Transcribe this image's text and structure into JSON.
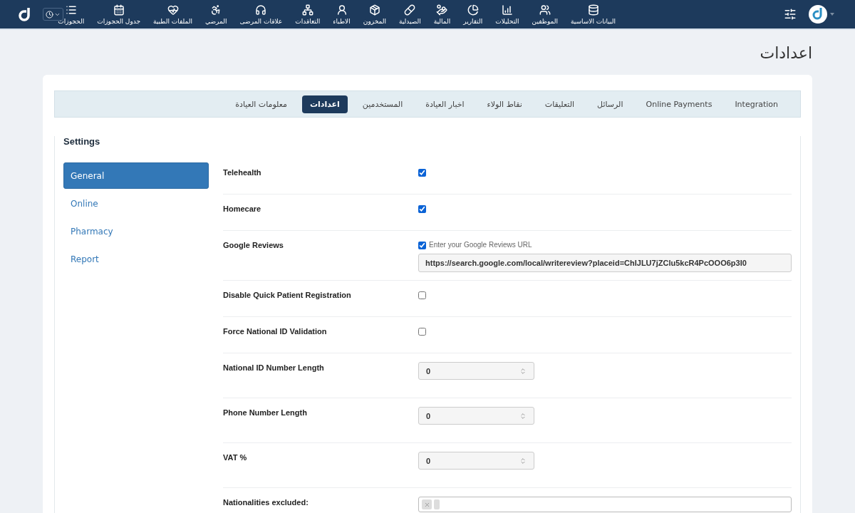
{
  "nav": {
    "items": [
      {
        "label": "البيانات الاساسية"
      },
      {
        "label": "الموظفين"
      },
      {
        "label": "التحليلات"
      },
      {
        "label": "التقارير"
      },
      {
        "label": "المالية"
      },
      {
        "label": "الصيدلية"
      },
      {
        "label": "المخزون"
      },
      {
        "label": "الاطباء"
      },
      {
        "label": "التعاقدات"
      },
      {
        "label": "علاقات المرضى"
      },
      {
        "label": "المرضي"
      },
      {
        "label": "الملفات الطبية"
      },
      {
        "label": "جدول الحجوزات"
      },
      {
        "label": "الحجوزات"
      }
    ]
  },
  "page_title": "اعدادات",
  "tabs": [
    {
      "label": "Integration",
      "selected": false
    },
    {
      "label": "Online Payments",
      "selected": false
    },
    {
      "label": "الرسائل",
      "selected": false
    },
    {
      "label": "التعليقات",
      "selected": false
    },
    {
      "label": "نقاط الولاء",
      "selected": false
    },
    {
      "label": "اخبار العيادة",
      "selected": false
    },
    {
      "label": "المستخدمين",
      "selected": false
    },
    {
      "label": "اعدادات",
      "selected": true
    },
    {
      "label": "معلومات العيادة",
      "selected": false
    }
  ],
  "settings": {
    "heading": "Settings",
    "sidebar": [
      {
        "label": "General",
        "selected": true
      },
      {
        "label": "Online",
        "selected": false
      },
      {
        "label": "Pharmacy",
        "selected": false
      },
      {
        "label": "Report",
        "selected": false
      }
    ],
    "rows": [
      {
        "kind": "checkbox",
        "label": "Telehealth",
        "checked": true
      },
      {
        "kind": "checkbox",
        "label": "Homecare",
        "checked": true
      },
      {
        "kind": "url",
        "label": "Google Reviews",
        "checked": true,
        "check_label": "Enter your Google Reviews URL",
        "value": "https://search.google.com/local/writereview?placeid=ChIJLU7jZClu5kcR4PcOOO6p3I0"
      },
      {
        "kind": "checkbox",
        "label": "Disable Quick Patient Registration",
        "checked": false
      },
      {
        "kind": "checkbox",
        "label": "Force National ID Validation",
        "checked": false
      },
      {
        "kind": "number",
        "label": "National ID Number Length",
        "value": "0"
      },
      {
        "kind": "number",
        "label": "Phone Number Length",
        "value": "0"
      },
      {
        "kind": "number",
        "label": "VAT %",
        "value": "0"
      },
      {
        "kind": "multiselect",
        "label": "Nationalities excluded:"
      }
    ]
  }
}
